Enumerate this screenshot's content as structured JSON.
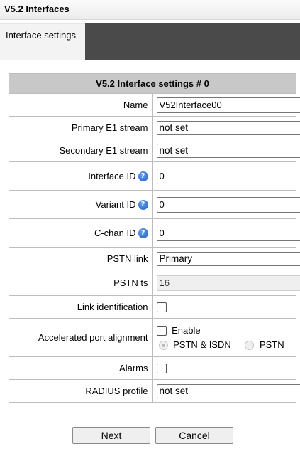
{
  "header": {
    "title": "V5.2 Interfaces"
  },
  "tabs": [
    {
      "label": "Interface settings",
      "active": true
    }
  ],
  "form": {
    "title": "V5.2 Interface settings # 0",
    "name": {
      "label": "Name",
      "value": "V52Interface00"
    },
    "primary_e1": {
      "label": "Primary E1 stream",
      "value": "not set"
    },
    "secondary_e1": {
      "label": "Secondary E1 stream",
      "value": "not set"
    },
    "interface_id": {
      "label": "Interface ID",
      "value": "0"
    },
    "variant_id": {
      "label": "Variant ID",
      "value": "0"
    },
    "cchan_id": {
      "label": "C-chan ID",
      "value": "0"
    },
    "pstn_link": {
      "label": "PSTN link",
      "value": "Primary"
    },
    "pstn_ts": {
      "label": "PSTN ts",
      "value": "16"
    },
    "link_identification": {
      "label": "Link identification",
      "checked": false
    },
    "accelerated": {
      "label": "Accelerated port alignment",
      "enable_label": "Enable",
      "enabled": false,
      "options": [
        "PSTN & ISDN",
        "PSTN"
      ],
      "selected": "PSTN & ISDN"
    },
    "alarms": {
      "label": "Alarms",
      "checked": false
    },
    "radius_profile": {
      "label": "RADIUS profile",
      "value": "not set"
    }
  },
  "buttons": {
    "next": "Next",
    "cancel": "Cancel"
  },
  "icons": {
    "help": "help-icon"
  }
}
